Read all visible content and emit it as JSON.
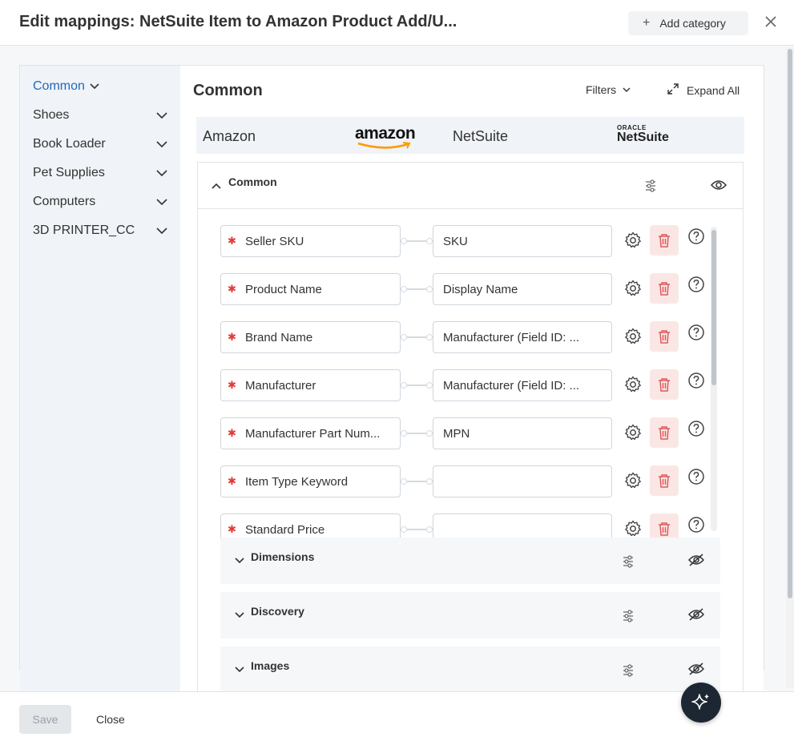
{
  "header": {
    "title": "Edit mappings: NetSuite Item to Amazon Product Add/U...",
    "add_category_label": "Add category"
  },
  "sidebar": {
    "items": [
      {
        "label": "Common"
      },
      {
        "label": "Shoes"
      },
      {
        "label": "Book Loader"
      },
      {
        "label": "Pet Supplies"
      },
      {
        "label": "Computers"
      },
      {
        "label": "3D PRINTER_CC"
      }
    ]
  },
  "main": {
    "title": "Common",
    "filters_label": "Filters",
    "expand_all_label": "Expand All",
    "app_bar": {
      "left_app": "Amazon",
      "left_logo_text": "amazon",
      "right_app": "NetSuite",
      "right_logo_top": "ORACLE",
      "right_logo_main": "NetSuite"
    },
    "section": {
      "label": "Common",
      "rows": [
        {
          "source": "Seller SKU",
          "destination": "SKU"
        },
        {
          "source": "Product Name",
          "destination": "Display Name"
        },
        {
          "source": "Brand Name",
          "destination": "Manufacturer (Field ID: ..."
        },
        {
          "source": "Manufacturer",
          "destination": "Manufacturer (Field ID: ..."
        },
        {
          "source": "Manufacturer Part Num...",
          "destination": "MPN"
        },
        {
          "source": "Item Type Keyword",
          "destination": ""
        },
        {
          "source": "Standard Price",
          "destination": ""
        }
      ]
    },
    "subsections": [
      {
        "label": "Dimensions"
      },
      {
        "label": "Discovery"
      },
      {
        "label": "Images"
      }
    ]
  },
  "footer": {
    "save_label": "Save",
    "close_label": "Close"
  },
  "colors": {
    "accent": "#1f6bb8",
    "required": "#e53935",
    "delete_bg": "#fbe6e6",
    "delete_icon": "#e05a5a"
  }
}
